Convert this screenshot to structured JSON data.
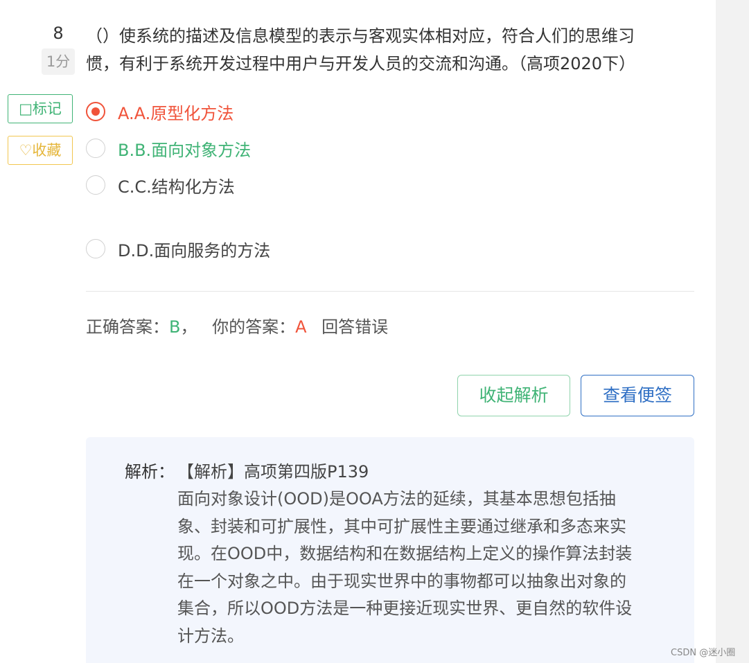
{
  "question": {
    "number": "8",
    "score": "1分",
    "text_lines": [
      "（）使系统的描述及信息模型的表示与客观实体相对应，符合人们的思维习",
      "惯，有利于系统开发过程中用户与开发人员的交流和沟通。（高项2020下）"
    ]
  },
  "tags": {
    "mark": "□标记",
    "favorite": "♡收藏"
  },
  "options": [
    {
      "label": "A.A.原型化方法",
      "state": "selected-wrong"
    },
    {
      "label": "B.B.面向对象方法",
      "state": "correct"
    },
    {
      "label": "C.C.结构化方法",
      "state": "normal"
    },
    {
      "label": "D.D.面向服务的方法",
      "state": "normal"
    }
  ],
  "result": {
    "correct_prefix": "正确答案：",
    "correct_value": "B",
    "separator": "，",
    "yours_prefix": "你的答案：",
    "yours_value": "A",
    "verdict": "回答错误"
  },
  "buttons": {
    "collapse": "收起解析",
    "notes": "查看便签"
  },
  "analysis": {
    "title": "解析：",
    "heading": "【解析】高项第四版P139",
    "body_lines": [
      "面向对象设计(OOD)是OOA方法的延续，其基本思想包括抽",
      "象、封装和可扩展性，其中可扩展性主要通过继承和多态来实",
      "现。在OOD中，数据结构和在数据结构上定义的操作算法封装",
      "在一个对象之中。由于现实世界中的事物都可以抽象出对象的",
      "集合，所以OOD方法是一种更接近现实世界、更自然的软件设",
      "计方法。"
    ]
  },
  "watermark": "CSDN @迷小圈",
  "colors": {
    "wrong": "#f0533a",
    "correct": "#3fb375",
    "primary": "#2f6fc4",
    "favorite": "#e5b63a",
    "analysis_bg": "#f3f6fd"
  }
}
